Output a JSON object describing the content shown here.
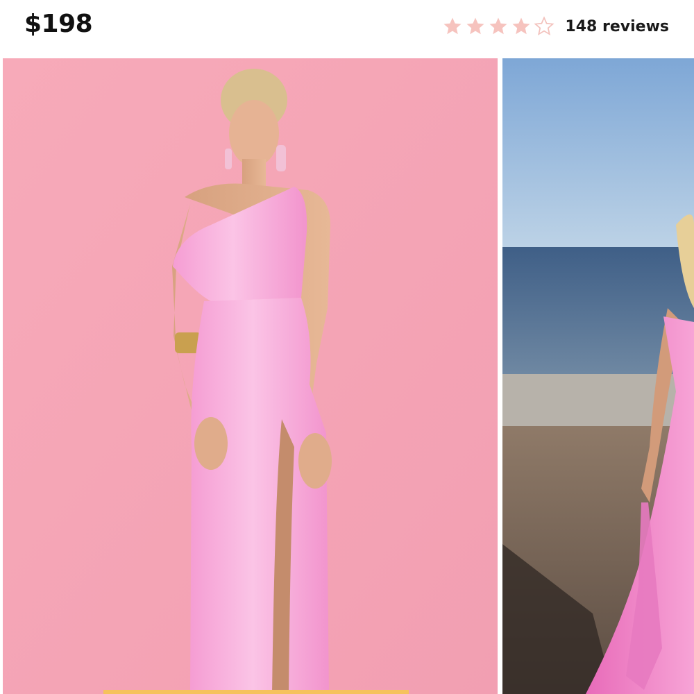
{
  "product": {
    "price": "$198",
    "rating": 4,
    "rating_max": 5,
    "review_count_label": "148 reviews"
  },
  "colors": {
    "star_filled": "#f6c3be",
    "star_empty_outline": "#f3c2bd",
    "backdrop_pink": "#f5a6b6",
    "dress_pink": "#f7a8d8"
  },
  "icons": {
    "rating_star": "star-icon"
  },
  "gallery": {
    "images": [
      {
        "name": "studio-photo"
      },
      {
        "name": "beach-photo"
      }
    ]
  }
}
